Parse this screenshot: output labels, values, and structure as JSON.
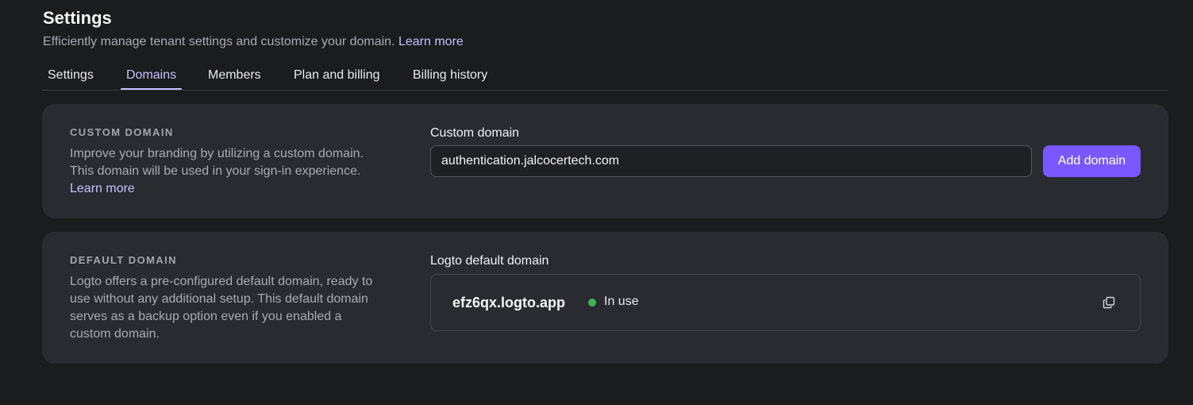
{
  "header": {
    "title": "Settings",
    "subtitle": "Efficiently manage tenant settings and customize your domain.",
    "learn_more": "Learn more"
  },
  "tabs": [
    {
      "label": "Settings",
      "active": false
    },
    {
      "label": "Domains",
      "active": true
    },
    {
      "label": "Members",
      "active": false
    },
    {
      "label": "Plan and billing",
      "active": false
    },
    {
      "label": "Billing history",
      "active": false
    }
  ],
  "custom_domain": {
    "heading": "CUSTOM DOMAIN",
    "description": "Improve your branding by utilizing a custom domain. This domain will be used in your sign-in experience.",
    "learn_more": "Learn more",
    "field_label": "Custom domain",
    "input_value": "authentication.jalcocertech.com",
    "button_label": "Add domain"
  },
  "default_domain": {
    "heading": "DEFAULT DOMAIN",
    "description": "Logto offers a pre-configured default domain, ready to use without any additional setup. This default domain serves as a backup option even if you enabled a custom domain.",
    "field_label": "Logto default domain",
    "domain": "efz6qx.logto.app",
    "status": "In use",
    "status_color": "#3fb256",
    "copy_icon": "copy-icon"
  },
  "colors": {
    "accent": "#7958ff",
    "link": "#cabeff",
    "card_bg": "#2a2b31",
    "page_bg": "#1a1c1d"
  }
}
